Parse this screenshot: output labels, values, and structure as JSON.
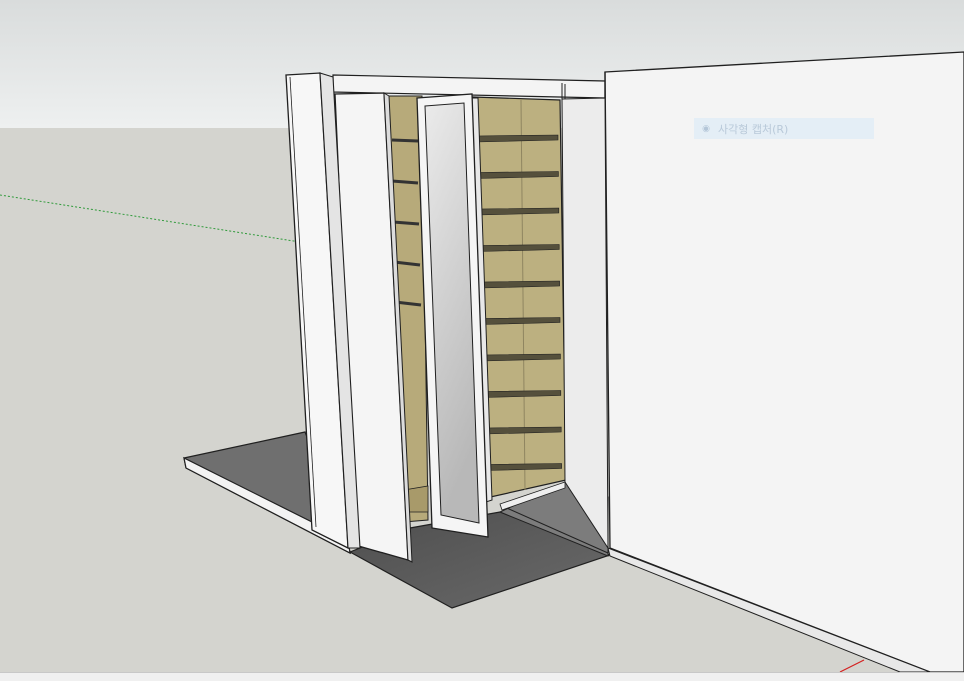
{
  "tooltip": {
    "label": "사각형 캡처(R)",
    "icon": "rectangle-capture-icon"
  },
  "scene": {
    "sky_color": "#e4e6e6",
    "ground_color": "#d4d4cf",
    "wall_color": "#f2f2f2",
    "wood_color": "#b9ad7e",
    "floor_color": "#6e6e6e",
    "mirror_color": "#cfcfcf",
    "green_axis_color": "#2f9a3a",
    "red_axis_color": "#d42020"
  }
}
